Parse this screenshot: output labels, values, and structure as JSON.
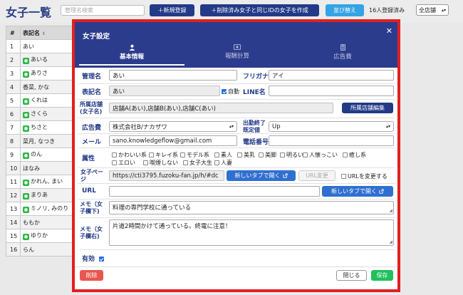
{
  "page": {
    "title": "女子一覧",
    "search_placeholder": "管理名検索",
    "new_button": "＋新規登録",
    "create_button": "＋削除済み女子と同じIDの女子を作成",
    "sort_button": "並び替え",
    "registered_count": "16人登録済み",
    "store_select": "全店舗"
  },
  "list": {
    "headers": [
      "#",
      "表記名"
    ],
    "rows": [
      {
        "no": "1",
        "name": "あい",
        "line": false
      },
      {
        "no": "2",
        "name": "あいる",
        "line": true
      },
      {
        "no": "3",
        "name": "ありさ",
        "line": true
      },
      {
        "no": "4",
        "name": "香菜, かな",
        "line": false
      },
      {
        "no": "5",
        "name": "くれは",
        "line": true
      },
      {
        "no": "6",
        "name": "さくら",
        "line": true
      },
      {
        "no": "7",
        "name": "ちさと",
        "line": true
      },
      {
        "no": "8",
        "name": "菜月, なつき",
        "line": false
      },
      {
        "no": "9",
        "name": "のん",
        "line": true
      },
      {
        "no": "10",
        "name": "ほなみ",
        "line": false
      },
      {
        "no": "11",
        "name": "かれん, まい",
        "line": true
      },
      {
        "no": "12",
        "name": "まりあ",
        "line": true
      },
      {
        "no": "13",
        "name": "ミノリ, みのり",
        "line": true
      },
      {
        "no": "14",
        "name": "ももか",
        "line": false
      },
      {
        "no": "15",
        "name": "ゆりか",
        "line": true
      },
      {
        "no": "16",
        "name": "らん",
        "line": false
      }
    ]
  },
  "modal": {
    "title": "女子設定",
    "tabs": [
      {
        "label": "基本情報",
        "icon": "user-icon",
        "active": true
      },
      {
        "label": "報酬計算",
        "icon": "money-icon",
        "active": false
      },
      {
        "label": "広告費",
        "icon": "calculator-icon",
        "active": false
      }
    ],
    "labels": {
      "admin_name": "管理名",
      "furigana": "フリガナ",
      "display_name": "表記名",
      "auto": "自動",
      "line_name": "LINE名",
      "store_line1": "所属店舗",
      "store_line2": "(女子名)",
      "ad_fee": "広告費",
      "shift_end_line1": "出勤終了",
      "shift_end_line2": "既定値",
      "mail": "メール",
      "phone": "電話番号",
      "attributes": "属性",
      "girls_page_line1": "女子ぺー",
      "girls_page_line2": "ジ",
      "url": "URL",
      "memo_lower_line1": "メモ（女",
      "memo_lower_line2": "子欄下)",
      "memo_right_line1": "メモ（女",
      "memo_right_line2": "子欄右)",
      "valid": "有効",
      "url_change_check": "URLを変更する"
    },
    "values": {
      "admin_name": "あい",
      "furigana": "アイ",
      "display_name": "あい",
      "line_name": "",
      "store": "店舗A(あい),店舗B(あい),店舗C(あい)",
      "ad_fee": "株式会社B/ナカザワ",
      "shift_end": "Up",
      "mail": "sano.knowledgeflow@gmail.com",
      "phone": "",
      "girls_page_url": "https://cti3795.fuzoku-fan.jp/h/#dc",
      "url": "",
      "memo_lower": "料理の専門学校に通っている",
      "memo_right": "片道2時間かけて通っている。終電に注意！"
    },
    "attributes": [
      "かわいい系",
      "キレイ系",
      "モデル系",
      "素人",
      "美乳",
      "美脚",
      "明るい",
      "人懐っこい",
      "癒し系",
      "エロい",
      "喫煙しない",
      "女子大生",
      "人妻"
    ],
    "buttons": {
      "store_edit": "所属店舗編集",
      "open_new_tab": "新しいタブで開く",
      "url_change": "URL変更",
      "open_new_tab_2": "新しいタブで開く",
      "delete": "削除",
      "close": "閉じる",
      "save": "保存"
    }
  },
  "colors": {
    "navy": "#2c3c8d",
    "button_blue": "#223a87",
    "light_blue": "#35a3e4",
    "delete_red": "#e9564f",
    "save_green": "#1ec15a",
    "outline_red": "#e02020"
  }
}
